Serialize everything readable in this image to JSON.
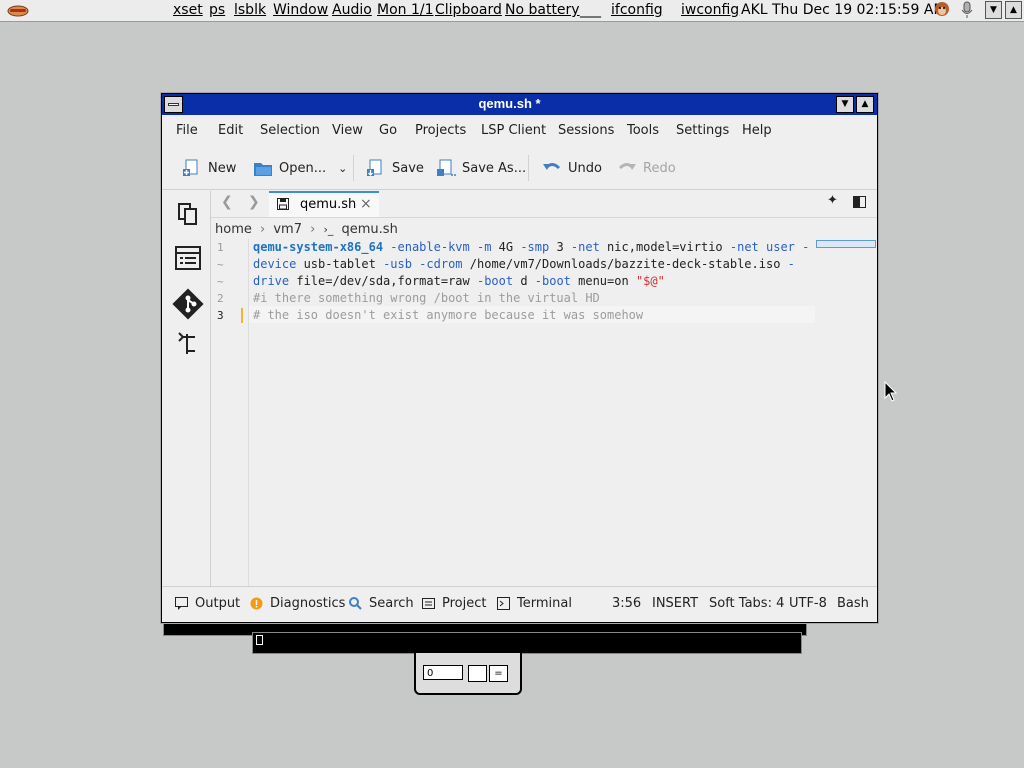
{
  "topbar": {
    "items": [
      "xset",
      "ps",
      "lsblk",
      "Window",
      "Audio",
      "Mon 1/1",
      "Clipboard",
      "No battery",
      "___",
      "ifconfig",
      "iwconfig"
    ],
    "clock": "AKL Thu Dec 19 02:15:59 AM"
  },
  "window": {
    "title": "qemu.sh *",
    "menu": [
      "File",
      "Edit",
      "Selection",
      "View",
      "Go",
      "Projects",
      "LSP Client",
      "Sessions",
      "Tools",
      "Settings",
      "Help"
    ],
    "toolbar": {
      "new": "New",
      "open": "Open...",
      "save": "Save",
      "save_as": "Save As...",
      "undo": "Undo",
      "redo": "Redo"
    },
    "tab": {
      "label": "qemu.sh",
      "close": "×"
    },
    "breadcrumb": {
      "home": "home",
      "dir": "vm7",
      "file": "qemu.sh"
    },
    "gutter": [
      "1",
      "~",
      "~",
      "2",
      "3"
    ],
    "code": {
      "line1_cmd": "qemu-system-x86_64",
      "line1_a": " -enable-kvm -m ",
      "line1_b": "4G",
      "line1_c": " -smp ",
      "line1_d": "3",
      "line1_e": " -net ",
      "line1_f": "nic,model=virtio",
      "line1_g": " -net ",
      "line1_h": "user -",
      "line2_a": "device",
      "line2_b": " usb-tablet ",
      "line2_c": "-usb -cdrom",
      "line2_d": " /home/vm7/Downloads/bazzite-deck-stable.iso ",
      "line2_e": "-",
      "line3_a": "drive",
      "line3_b": " file=/dev/sda,format=raw ",
      "line3_c": "-boot",
      "line3_d": " d ",
      "line3_e": "-boot",
      "line3_f": " menu=on ",
      "line3_g": "\"$@\"",
      "line4": "#i there something wrong /boot in the virtual HD",
      "line5": "# the iso doesn't exist anymore because it was somehow"
    },
    "status": {
      "output": "Output",
      "diagnostics": "Diagnostics",
      "search": "Search",
      "project": "Project",
      "terminal": "Terminal",
      "position": "3:56",
      "mode": "INSERT",
      "tabs": "Soft Tabs: 4",
      "encoding": "UTF-8",
      "lang": "Bash"
    }
  },
  "colors": {
    "titlebar": "#0a2ea8",
    "accent": "#3d8ed8",
    "keyword": "#1f73c2",
    "string": "#cc3333"
  }
}
